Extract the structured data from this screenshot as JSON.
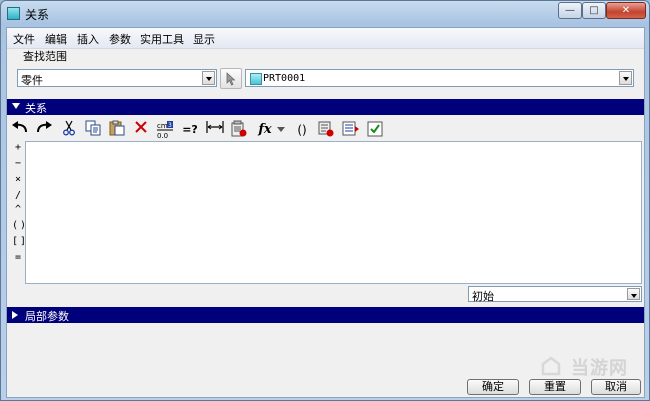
{
  "window": {
    "title": "关系",
    "min_glyph": "—",
    "max_glyph": "□",
    "close_glyph": "✕"
  },
  "menu": [
    "文件",
    "编辑",
    "插入",
    "参数",
    "实用工具",
    "显示"
  ],
  "scope": {
    "label": "查找范围",
    "type_value": "零件",
    "model_value": "PRT0001"
  },
  "relations_section": {
    "label": "关系"
  },
  "toolbar_icons": [
    "undo-icon",
    "redo-icon",
    "cut-icon",
    "copy-icon",
    "paste-icon",
    "delete-icon",
    "unit-sensitivity-icon",
    "evaluate-icon",
    "insert-dimension-icon",
    "insert-parameter-icon",
    "function-icon",
    "parentheses-icon",
    "sort-relations-icon",
    "insert-relation-icon",
    "verify-icon"
  ],
  "toolbar_text": {
    "evaluate": "=?",
    "function": "fx",
    "parentheses": "()",
    "unit_top": "cm",
    "unit_num": "3",
    "unit_bottom": "0.0"
  },
  "operators": [
    "+",
    "−",
    "×",
    "/",
    "^",
    "( )",
    "[ ]",
    "="
  ],
  "status_select": {
    "value": "初始"
  },
  "local_params_section": {
    "label": "局部参数"
  },
  "buttons": {
    "ok": "确定",
    "reset": "重置",
    "cancel": "取消"
  },
  "watermark": {
    "text": "当游网"
  },
  "colors": {
    "section_bar": "#00007b",
    "close_button": "#c4432e"
  }
}
